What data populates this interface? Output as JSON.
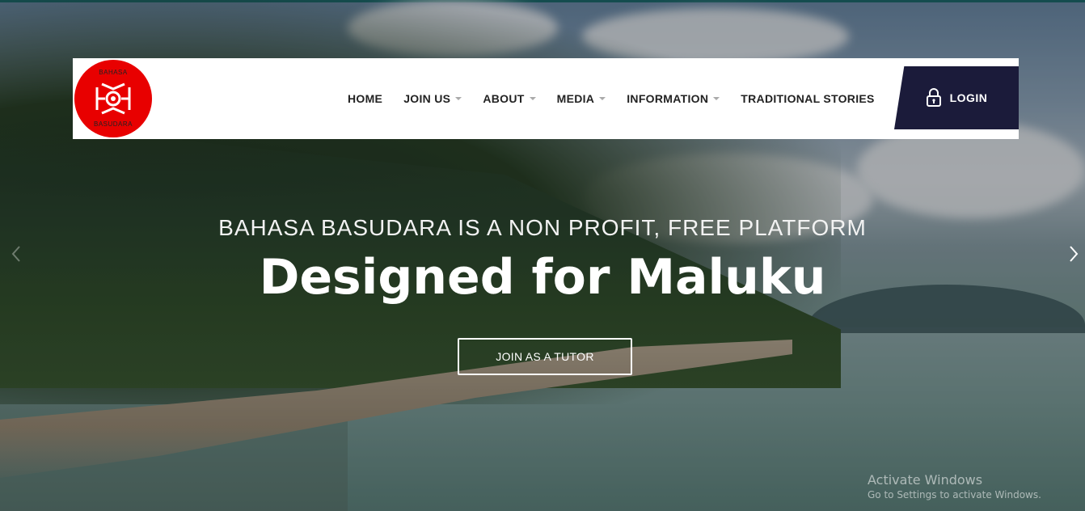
{
  "header": {
    "logo": {
      "top_text": "BAHASA",
      "bottom_text": "BASUDARA",
      "color": "#e80000"
    },
    "nav": [
      {
        "label": "HOME",
        "has_dropdown": false
      },
      {
        "label": "JOIN US",
        "has_dropdown": true
      },
      {
        "label": "ABOUT",
        "has_dropdown": true
      },
      {
        "label": "MEDIA",
        "has_dropdown": true
      },
      {
        "label": "INFORMATION",
        "has_dropdown": true
      },
      {
        "label": "TRADITIONAL STORIES",
        "has_dropdown": false
      }
    ],
    "login": {
      "label": "LOGIN",
      "icon": "lock-icon",
      "background": "#1b1b3a"
    }
  },
  "hero": {
    "subtitle": "BAHASA BASUDARA IS A NON PROFIT, FREE PLATFORM",
    "title": "Designed for Maluku",
    "cta_label": "JOIN AS A TUTOR",
    "prev_icon": "chevron-left-icon",
    "next_icon": "chevron-right-icon"
  },
  "watermark": {
    "line1": "Activate Windows",
    "line2": "Go to Settings to activate Windows."
  }
}
